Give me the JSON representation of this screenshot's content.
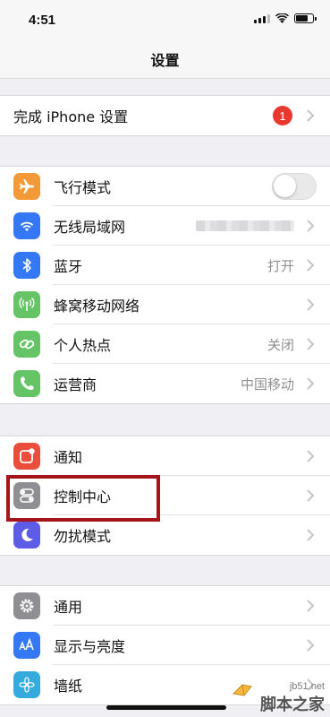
{
  "status_bar": {
    "time": "4:51"
  },
  "nav": {
    "title": "设置"
  },
  "setup": {
    "label": "完成 iPhone 设置",
    "badge": "1"
  },
  "connectivity": {
    "airplane": {
      "label": "飞行模式",
      "toggle_on": false,
      "icon": "airplane-icon",
      "color": "#f19a37"
    },
    "wifi": {
      "label": "无线局域网",
      "icon": "wifi-icon",
      "color": "#3478f6"
    },
    "bluetooth": {
      "label": "蓝牙",
      "value": "打开",
      "icon": "bluetooth-icon",
      "color": "#3478f6"
    },
    "cellular": {
      "label": "蜂窝移动网络",
      "icon": "cellular-icon",
      "color": "#65c466"
    },
    "hotspot": {
      "label": "个人热点",
      "value": "关闭",
      "icon": "hotspot-icon",
      "color": "#65c466"
    },
    "carrier": {
      "label": "运营商",
      "value": "中国移动",
      "icon": "phone-icon",
      "color": "#65c466"
    }
  },
  "system": {
    "notifications": {
      "label": "通知",
      "icon": "notifications-icon",
      "color": "#eb4d3d"
    },
    "control_center": {
      "label": "控制中心",
      "icon": "control-center-icon",
      "color": "#8e8e93"
    },
    "dnd": {
      "label": "勿扰模式",
      "icon": "moon-icon",
      "color": "#5e5ce6"
    }
  },
  "general": {
    "general": {
      "label": "通用",
      "icon": "gear-icon",
      "color": "#8e8e93"
    },
    "display": {
      "label": "显示与亮度",
      "icon": "text-size-icon",
      "color": "#3478f6"
    },
    "wallpaper": {
      "label": "墙纸",
      "icon": "flower-icon",
      "color": "#35aadc"
    }
  },
  "watermark": {
    "url": "jb51.net",
    "name": "脚本之家"
  }
}
